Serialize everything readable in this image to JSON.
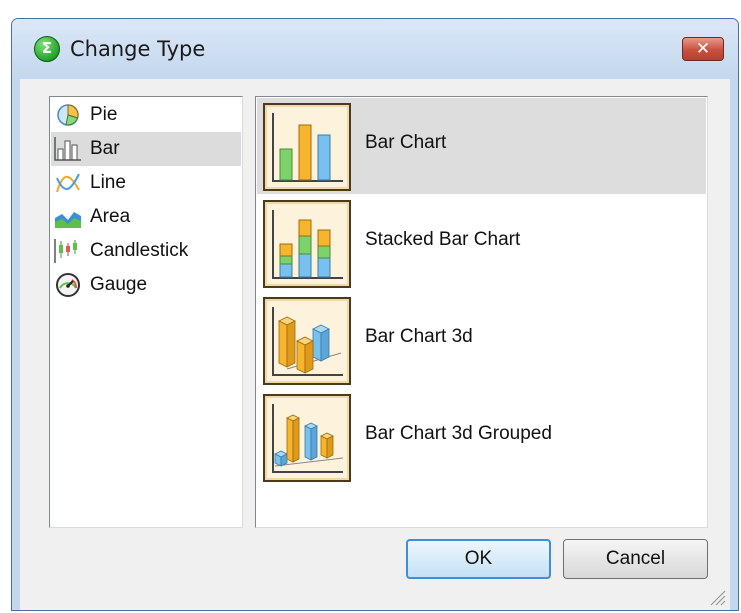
{
  "window": {
    "title": "Change Type",
    "app_icon_glyph": "Σ",
    "close_glyph": "✕"
  },
  "type_list": [
    {
      "label": "Pie",
      "icon": "pie-icon"
    },
    {
      "label": "Bar",
      "icon": "bar-icon",
      "selected": true
    },
    {
      "label": "Line",
      "icon": "line-icon"
    },
    {
      "label": "Area",
      "icon": "area-icon"
    },
    {
      "label": "Candlestick",
      "icon": "candlestick-icon"
    },
    {
      "label": "Gauge",
      "icon": "gauge-icon"
    }
  ],
  "chart_list": [
    {
      "label": "Bar Chart",
      "icon": "bar-chart-thumbnail",
      "selected": true
    },
    {
      "label": "Stacked Bar Chart",
      "icon": "stacked-bar-chart-thumbnail"
    },
    {
      "label": "Bar Chart 3d",
      "icon": "bar-chart-3d-thumbnail"
    },
    {
      "label": "Bar Chart 3d Grouped",
      "icon": "bar-chart-3d-grouped-thumbnail"
    }
  ],
  "buttons": {
    "ok": "OK",
    "cancel": "Cancel"
  },
  "colors": {
    "title_bar": "#c3d7ee",
    "close_button": "#c8503e",
    "selection": "#dcdcdc",
    "ok_border": "#3d8fd6",
    "bar_green": "#7cd36b",
    "bar_orange": "#f7b52e",
    "bar_blue": "#78c0ee"
  }
}
